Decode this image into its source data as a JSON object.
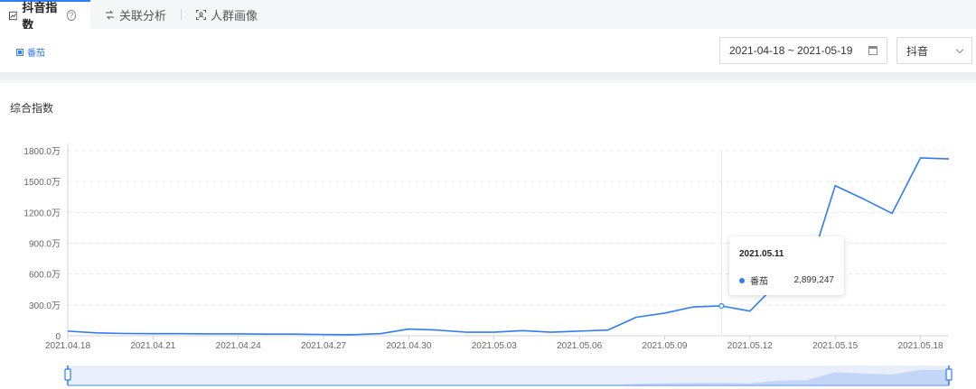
{
  "tabs": [
    {
      "label": "抖音指数",
      "active": true,
      "icon": "trend-chart-icon"
    },
    {
      "label": "关联分析",
      "active": false,
      "icon": "link-analysis-icon"
    },
    {
      "label": "人群画像",
      "active": false,
      "icon": "crowd-portrait-icon"
    }
  ],
  "toolbar": {
    "keyword_chip": "番茄",
    "date_range": "2021-04-18 ~ 2021-05-19",
    "platform": "抖音"
  },
  "section_title": "综合指数",
  "tooltip": {
    "date": "2021.05.11",
    "series": "番茄",
    "value": "2,899,247"
  },
  "colors": {
    "accent": "#2f7cf6",
    "grid": "#e6e8eb",
    "axis": "#666666"
  },
  "chart_data": {
    "type": "line",
    "ylim": [
      0,
      18000000
    ],
    "yticks": [
      0,
      3000000,
      6000000,
      9000000,
      12000000,
      15000000,
      18000000
    ],
    "ytick_labels": [
      "0",
      "300.0万",
      "600.0万",
      "900.0万",
      "1200.0万",
      "1500.0万",
      "1800.0万"
    ],
    "x": [
      "2021.04.18",
      "2021.04.19",
      "2021.04.20",
      "2021.04.21",
      "2021.04.22",
      "2021.04.23",
      "2021.04.24",
      "2021.04.25",
      "2021.04.26",
      "2021.04.27",
      "2021.04.28",
      "2021.04.29",
      "2021.04.30",
      "2021.05.01",
      "2021.05.02",
      "2021.05.03",
      "2021.05.04",
      "2021.05.05",
      "2021.05.06",
      "2021.05.07",
      "2021.05.08",
      "2021.05.09",
      "2021.05.10",
      "2021.05.11",
      "2021.05.12",
      "2021.05.13",
      "2021.05.14",
      "2021.05.15",
      "2021.05.16",
      "2021.05.17",
      "2021.05.18",
      "2021.05.19"
    ],
    "xtick_labels": [
      "2021.04.18",
      "2021.04.21",
      "2021.04.24",
      "2021.04.27",
      "2021.04.30",
      "2021.05.03",
      "2021.05.06",
      "2021.05.09",
      "2021.05.12",
      "2021.05.15",
      "2021.05.18"
    ],
    "series": [
      {
        "name": "番茄",
        "values": [
          450000,
          280000,
          220000,
          200000,
          200000,
          180000,
          180000,
          160000,
          160000,
          120000,
          100000,
          200000,
          650000,
          550000,
          350000,
          350000,
          500000,
          350000,
          450000,
          550000,
          1800000,
          2200000,
          2800000,
          2899247,
          2400000,
          5200000,
          5800000,
          14600000,
          13300000,
          11900000,
          17300000,
          17200000
        ]
      }
    ],
    "hover_index": 23
  }
}
